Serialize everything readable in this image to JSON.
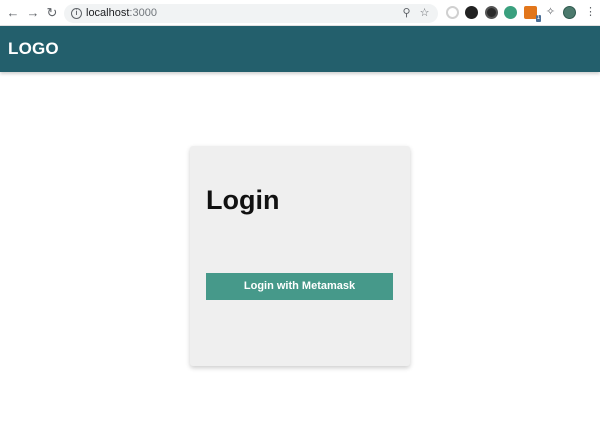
{
  "browser": {
    "url_host": "localhost",
    "url_port": ":3000",
    "back_icon": "arrow-left-icon",
    "forward_icon": "arrow-right-icon",
    "reload_icon": "reload-icon",
    "extension_badge": "1"
  },
  "header": {
    "logo_text": "LOGO",
    "background_color": "#235f6c"
  },
  "login_card": {
    "title": "Login",
    "button_label": "Login with Metamask",
    "button_color": "#46998a"
  }
}
